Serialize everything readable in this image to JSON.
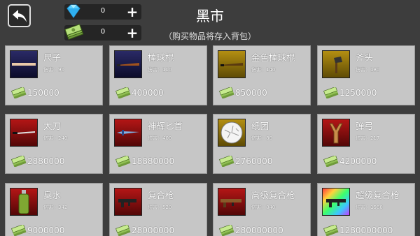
{
  "header": {
    "title": "黑市",
    "subtitle": "（购买物品将存入背包）"
  },
  "currencies": [
    {
      "icon": "diamond-icon",
      "value": "0"
    },
    {
      "icon": "cash-icon",
      "value": "0"
    }
  ],
  "items": [
    {
      "name": "尺子",
      "damage": "伤害：90",
      "price": "150000",
      "thumb": "blue",
      "icon": "ruler-icon"
    },
    {
      "name": "棒球棍",
      "damage": "伤害：110",
      "price": "400000",
      "thumb": "blue",
      "icon": "baseball-bat-icon"
    },
    {
      "name": "金色棒球棍",
      "damage": "伤害：140",
      "price": "850000",
      "thumb": "gold",
      "icon": "gold-baseball-bat-icon"
    },
    {
      "name": "斧头",
      "damage": "伤害：180",
      "price": "1250000",
      "thumb": "gold",
      "icon": "axe-icon"
    },
    {
      "name": "太刀",
      "damage": "伤害：240",
      "price": "2880000",
      "thumb": "red",
      "icon": "katana-icon"
    },
    {
      "name": "神辉匕首",
      "damage": "伤害：400",
      "price": "18880000",
      "thumb": "red",
      "icon": "dagger-icon"
    },
    {
      "name": "纸团",
      "damage": "伤害：80",
      "price": "2760000",
      "thumb": "gold",
      "icon": "paper-ball-icon"
    },
    {
      "name": "弹弓",
      "damage": "伤害：217",
      "price": "4200000",
      "thumb": "red",
      "icon": "slingshot-icon"
    },
    {
      "name": "臭水",
      "damage": "伤害：342",
      "price": "9000000",
      "thumb": "red",
      "icon": "stink-bottle-icon"
    },
    {
      "name": "复合枪",
      "damage": "伤害：520",
      "price": "28000000",
      "thumb": "red",
      "icon": "compound-gun-icon"
    },
    {
      "name": "高级复合枪",
      "damage": "伤害：840",
      "price": "280000000",
      "thumb": "red",
      "icon": "advanced-gun-icon"
    },
    {
      "name": "超级复合枪",
      "damage": "伤害：1560",
      "price": "1280000000",
      "thumb": "rainbow",
      "icon": "super-gun-icon"
    }
  ]
}
